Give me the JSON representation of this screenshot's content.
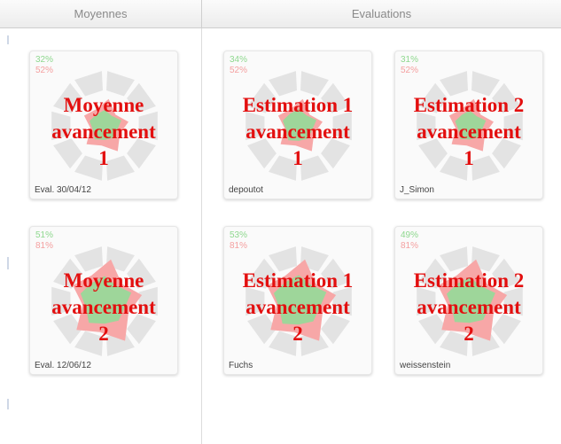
{
  "header": {
    "moyennes_label": "Moyennes",
    "evaluations_label": "Evaluations"
  },
  "cards": [
    {
      "pct_green": "32%",
      "pct_red": "52%",
      "caption": "Eval. 30/04/12",
      "overlay": [
        "Moyenne",
        "avancement",
        "1"
      ],
      "levels": {
        "green": 0.32,
        "red": 0.52
      }
    },
    {
      "pct_green": "34%",
      "pct_red": "52%",
      "caption": "depoutot",
      "overlay": [
        "Estimation 1",
        "avancement",
        "1"
      ],
      "levels": {
        "green": 0.34,
        "red": 0.52
      }
    },
    {
      "pct_green": "31%",
      "pct_red": "52%",
      "caption": "J_Simon",
      "overlay": [
        "Estimation 2",
        "avancement",
        "1"
      ],
      "levels": {
        "green": 0.31,
        "red": 0.52
      }
    },
    {
      "pct_green": "51%",
      "pct_red": "81%",
      "caption": "Eval. 12/06/12",
      "overlay": [
        "Moyenne",
        "avancement",
        "2"
      ],
      "levels": {
        "green": 0.51,
        "red": 0.81
      }
    },
    {
      "pct_green": "53%",
      "pct_red": "81%",
      "caption": "Fuchs",
      "overlay": [
        "Estimation 1",
        "avancement",
        "2"
      ],
      "levels": {
        "green": 0.53,
        "red": 0.81
      }
    },
    {
      "pct_green": "49%",
      "pct_red": "81%",
      "caption": "weissenstein",
      "overlay": [
        "Estimation 2",
        "avancement",
        "2"
      ],
      "levels": {
        "green": 0.49,
        "red": 0.81
      }
    }
  ],
  "colors": {
    "green_fill": "#9ed69a",
    "red_fill": "#f7a7a7",
    "grey_ring": "#e3e3e3",
    "overlay_text": "#e30f0f"
  }
}
